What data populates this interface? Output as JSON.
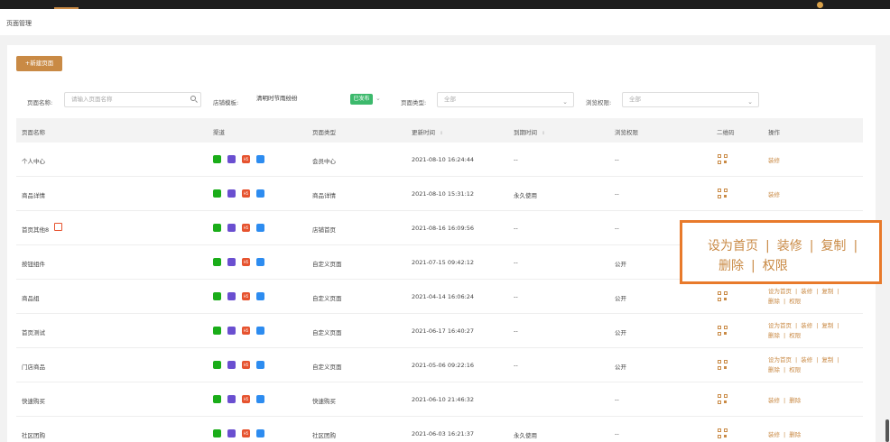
{
  "breadcrumb": "页面管理",
  "toolbar": {
    "new_label": "+新建页面"
  },
  "filters": {
    "name_label": "页面名称:",
    "name_placeholder": "请输入页面名称",
    "template_label": "店铺模板:",
    "template_value": "清明时节雨纷纷",
    "template_status": "已发布",
    "type_label": "页面类型:",
    "type_value": "全部",
    "permission_label": "浏览权限:",
    "permission_value": "全部"
  },
  "table": {
    "headers": [
      "页面名称",
      "渠道",
      "页面类型",
      "更新时间",
      "到期时间",
      "浏览权限",
      "二维码",
      "操作"
    ],
    "rows": [
      {
        "name": "个人中心",
        "type": "会员中心",
        "updated": "2021-08-10 16:24:44",
        "expire": "--",
        "permission": "--",
        "ops": [
          "装修"
        ]
      },
      {
        "name": "商品详情",
        "type": "商品详情",
        "updated": "2021-08-10 15:31:12",
        "expire": "永久使用",
        "permission": "--",
        "ops": [
          "装修"
        ]
      },
      {
        "name": "首页其他8",
        "type": "店铺首页",
        "updated": "2021-08-16 16:09:56",
        "expire": "--",
        "permission": "--",
        "ops": []
      },
      {
        "name": "按钮组件",
        "type": "自定义页面",
        "updated": "2021-07-15 09:42:12",
        "expire": "--",
        "permission": "公开",
        "ops": []
      },
      {
        "name": "商品组",
        "type": "自定义页面",
        "updated": "2021-04-14 16:06:24",
        "expire": "--",
        "permission": "公开",
        "ops": [
          "设为首页",
          "装修",
          "复制",
          "删除",
          "权限"
        ]
      },
      {
        "name": "首页测试",
        "type": "自定义页面",
        "updated": "2021-06-17 16:40:27",
        "expire": "--",
        "permission": "公开",
        "ops": [
          "设为首页",
          "装修",
          "复制",
          "删除",
          "权限"
        ]
      },
      {
        "name": "门店商品",
        "type": "自定义页面",
        "updated": "2021-05-06 09:22:16",
        "expire": "--",
        "permission": "公开",
        "ops": [
          "设为首页",
          "装修",
          "复制",
          "删除",
          "权限"
        ]
      },
      {
        "name": "快速购买",
        "type": "快速购买",
        "updated": "2021-06-10 21:46:32",
        "expire": "",
        "permission": "--",
        "ops": [
          "装修",
          "删除"
        ]
      },
      {
        "name": "社区团购",
        "type": "社区团购",
        "updated": "2021-06-03 16:21:37",
        "expire": "永久使用",
        "permission": "--",
        "ops": [
          "装修",
          "删除"
        ]
      }
    ]
  },
  "channel_icons": [
    "wechat-icon",
    "mini-program-icon",
    "h5-icon",
    "app-icon"
  ],
  "channel_labels": {
    "h5": "H5"
  },
  "callout": {
    "line1": [
      "设为首页",
      "装修",
      "复制"
    ],
    "line2": [
      "删除",
      "权限"
    ]
  },
  "colors": {
    "accent": "#c98a45",
    "callout_border": "#e87a2b",
    "status_green": "#3cb96c"
  }
}
